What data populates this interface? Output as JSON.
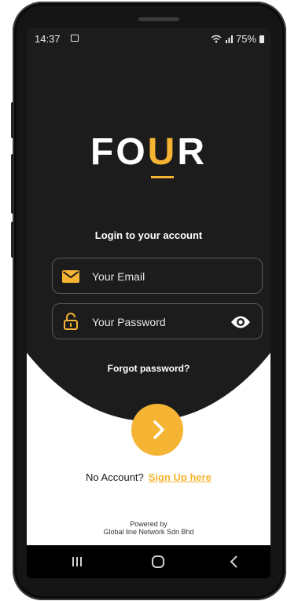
{
  "status_bar": {
    "time": "14:37",
    "battery": "75%"
  },
  "brand": {
    "prefix": "FO",
    "highlight": "U",
    "suffix": "R"
  },
  "login": {
    "title": "Login to your account",
    "email_placeholder": "Your Email",
    "email_value": "",
    "password_placeholder": "Your Password",
    "password_value": ""
  },
  "forgot_password": "Forgot password?",
  "signup": {
    "prompt": "No Account?",
    "link": "Sign Up here"
  },
  "footer": {
    "powered_by": "Powered by",
    "company": "Global line Network Sdn Bhd"
  },
  "colors": {
    "accent": "#f5b433",
    "background": "#1c1c1c"
  },
  "icons": {
    "email": "mail-icon",
    "password": "lock-icon",
    "visibility": "eye-icon",
    "submit": "chevron-right-icon",
    "nav": [
      "recents-icon",
      "home-icon",
      "back-icon"
    ]
  }
}
